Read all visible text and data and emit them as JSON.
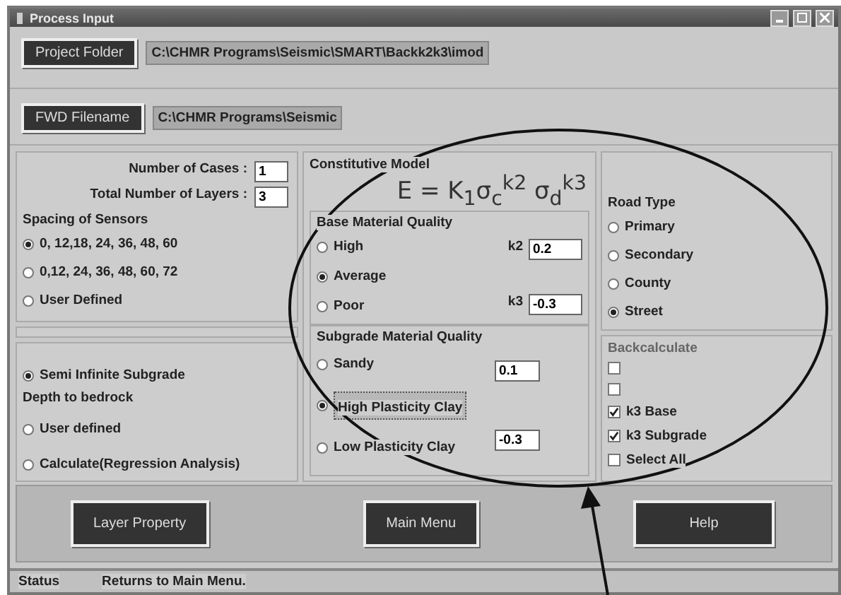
{
  "window": {
    "title": "Process Input"
  },
  "paths": [
    {
      "button": "Project Folder",
      "value": "C:\\CHMR Programs\\Seismic\\SMART\\Backk2k3\\imod"
    },
    {
      "button": "FWD Filename",
      "value": "C:\\CHMR Programs\\Seismic"
    }
  ],
  "counts": [
    {
      "label": "Number of Cases :",
      "value": "1"
    },
    {
      "label": "Total Number of Layers :",
      "value": "3"
    }
  ],
  "sensor_spacing": {
    "title": "Spacing of Sensors",
    "options": [
      {
        "label": "0, 12,18, 24, 36, 48, 60",
        "selected": true
      },
      {
        "label": "0,12, 24, 36, 48, 60, 72",
        "selected": false
      },
      {
        "label": "User Defined",
        "selected": false
      }
    ]
  },
  "subgrade_depth": {
    "semi_infinite": {
      "label": "Semi Infinite Subgrade",
      "selected": true
    },
    "title": "Depth to bedrock",
    "options": [
      {
        "label": "User defined",
        "selected": false
      },
      {
        "label": "Calculate(Regression Analysis)",
        "selected": false
      }
    ]
  },
  "constitutive_model": {
    "title": "Constitutive Model",
    "equation": "E = K$_{1}$σ$_{c}$$^{k2}$ σ$_{d}$$^{k3}$"
  },
  "base_quality": {
    "title": "Base Material Quality",
    "options": [
      {
        "label": "High",
        "selected": false
      },
      {
        "label": "Average",
        "selected": true
      },
      {
        "label": "Poor",
        "selected": false
      }
    ],
    "coefficients": [
      {
        "label": "k2",
        "value": "0.2"
      },
      {
        "label": "k3",
        "value": "-0.3"
      }
    ]
  },
  "subgrade_quality": {
    "title": "Subgrade Material Quality",
    "options": [
      {
        "label": "Sandy",
        "selected": false
      },
      {
        "label": "High Plasticity Clay",
        "selected": true
      },
      {
        "label": "Low Plasticity Clay",
        "selected": false
      }
    ],
    "coefficients": [
      {
        "value": "0.1"
      },
      {
        "value": "-0.3"
      }
    ]
  },
  "road_type": {
    "title": "Road Type",
    "options": [
      {
        "label": "Primary",
        "selected": false
      },
      {
        "label": "Secondary",
        "selected": false
      },
      {
        "label": "County",
        "selected": false
      },
      {
        "label": "Street",
        "selected": true
      }
    ]
  },
  "backcalculate": {
    "title": "Backcalculate",
    "items": [
      {
        "checked": false
      },
      {
        "checked": false
      },
      {
        "label": "k3 Base",
        "checked": true
      },
      {
        "label": "k3 Subgrade",
        "checked": true
      },
      {
        "label": "Select All",
        "checked": false
      }
    ]
  },
  "buttons": [
    "Layer Property",
    "Main Menu",
    "Help"
  ],
  "status_bar": {
    "label": "Status",
    "message": "Returns to Main Menu."
  }
}
